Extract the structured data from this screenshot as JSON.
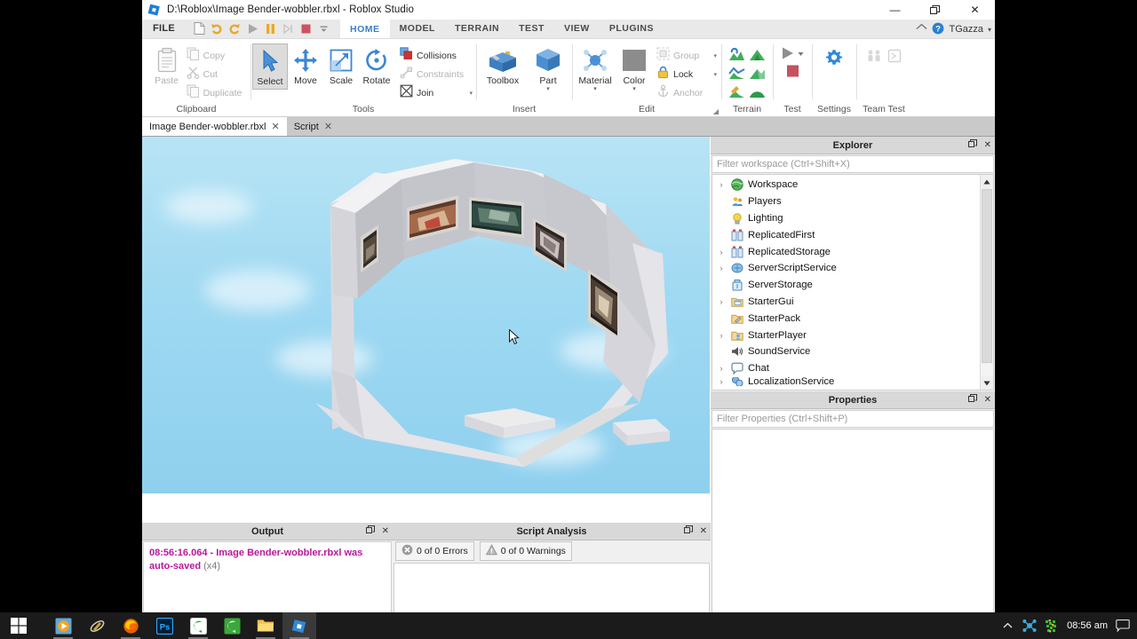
{
  "window": {
    "title": "D:\\Roblox\\Image Bender-wobbler.rbxl - Roblox Studio",
    "icon": "roblox-studio-icon",
    "minimize_label": "—",
    "restore_label": "❐",
    "close_label": "✕"
  },
  "ribbon": {
    "file_tab": "FILE",
    "quick_access": [
      {
        "name": "new-document",
        "label": "New"
      },
      {
        "name": "undo",
        "label": "Undo"
      },
      {
        "name": "redo",
        "label": "Redo"
      },
      {
        "name": "play",
        "label": "Play"
      },
      {
        "name": "pause",
        "label": "Pause"
      },
      {
        "name": "step",
        "label": "Step"
      },
      {
        "name": "stop",
        "label": "Stop"
      },
      {
        "name": "qat-overflow",
        "label": "More"
      }
    ],
    "tabs": [
      {
        "label": "HOME",
        "active": true
      },
      {
        "label": "MODEL",
        "active": false
      },
      {
        "label": "TERRAIN",
        "active": false
      },
      {
        "label": "TEST",
        "active": false
      },
      {
        "label": "VIEW",
        "active": false
      },
      {
        "label": "PLUGINS",
        "active": false
      }
    ],
    "account": {
      "home_icon": "home-icon",
      "help_icon": "help-icon",
      "user_name": "TGazza",
      "caret": "▾"
    },
    "groups": [
      {
        "name": "clipboard",
        "label": "Clipboard",
        "big": [
          {
            "label": "Paste",
            "icon": "paste-icon",
            "disabled": true
          }
        ],
        "small": [
          {
            "label": "Copy",
            "icon": "copy-icon",
            "disabled": true
          },
          {
            "label": "Cut",
            "icon": "cut-icon",
            "disabled": true
          },
          {
            "label": "Duplicate",
            "icon": "duplicate-icon",
            "disabled": true
          }
        ]
      },
      {
        "name": "tools",
        "label": "Tools",
        "big": [
          {
            "label": "Select",
            "icon": "select-arrow-icon",
            "selected": true
          },
          {
            "label": "Move",
            "icon": "move-icon"
          },
          {
            "label": "Scale",
            "icon": "scale-icon"
          },
          {
            "label": "Rotate",
            "icon": "rotate-icon"
          }
        ],
        "small": [
          {
            "label": "Collisions",
            "icon": "collisions-icon",
            "disabled": false
          },
          {
            "label": "Constraints",
            "icon": "constraints-icon",
            "disabled": true
          },
          {
            "label": "Join",
            "icon": "join-icon",
            "disabled": false,
            "caret": "▾"
          }
        ]
      },
      {
        "name": "insert",
        "label": "Insert",
        "big": [
          {
            "label": "Toolbox",
            "icon": "toolbox-icon"
          },
          {
            "label": "Part",
            "icon": "part-cube-icon",
            "caret": "▾"
          }
        ]
      },
      {
        "name": "edit",
        "label": "Edit",
        "big": [
          {
            "label": "Material",
            "icon": "material-icon",
            "caret": "▾"
          },
          {
            "label": "Color",
            "icon": "color-swatch-icon",
            "caret": "▾"
          }
        ],
        "small": [
          {
            "label": "Group",
            "icon": "group-icon",
            "disabled": true,
            "caret": "▾"
          },
          {
            "label": "Lock",
            "icon": "lock-icon",
            "disabled": false,
            "caret": "▾"
          },
          {
            "label": "Anchor",
            "icon": "anchor-icon",
            "disabled": true
          }
        ],
        "expander": "◢"
      },
      {
        "name": "terrain",
        "label": "Terrain",
        "tiles": [
          "terrain-editor-icon",
          "terrain-add-icon",
          "terrain-smooth-icon",
          "terrain-subtract-icon",
          "terrain-paint-icon",
          "terrain-grow-icon"
        ]
      },
      {
        "name": "test",
        "label": "Test",
        "tiles": [
          "play-solo-icon",
          "stop-icon"
        ]
      },
      {
        "name": "settings",
        "label": "Settings",
        "tiles": [
          "gear-icon"
        ]
      },
      {
        "name": "team-test",
        "label": "Team Test",
        "tiles": [
          "team-players-icon",
          "team-server-icon"
        ]
      }
    ]
  },
  "doctabs": [
    {
      "label": "Image Bender-wobbler.rbxl",
      "close": "✕",
      "active": true
    },
    {
      "label": "Script",
      "close": "✕",
      "active": false
    }
  ],
  "explorer": {
    "title": "Explorer",
    "float_icon": "❐",
    "close_icon": "✕",
    "filter_placeholder": "Filter workspace (Ctrl+Shift+X)",
    "items": [
      {
        "label": "Workspace",
        "icon": "workspace-globe-icon",
        "expandable": true
      },
      {
        "label": "Players",
        "icon": "players-icon",
        "expandable": false
      },
      {
        "label": "Lighting",
        "icon": "lighting-bulb-icon",
        "expandable": false
      },
      {
        "label": "ReplicatedFirst",
        "icon": "replicated-first-icon",
        "expandable": false
      },
      {
        "label": "ReplicatedStorage",
        "icon": "replicated-storage-icon",
        "expandable": true
      },
      {
        "label": "ServerScriptService",
        "icon": "server-script-service-icon",
        "expandable": true
      },
      {
        "label": "ServerStorage",
        "icon": "server-storage-icon",
        "expandable": false
      },
      {
        "label": "StarterGui",
        "icon": "starter-gui-icon",
        "expandable": true
      },
      {
        "label": "StarterPack",
        "icon": "starter-pack-icon",
        "expandable": false
      },
      {
        "label": "StarterPlayer",
        "icon": "starter-player-icon",
        "expandable": true
      },
      {
        "label": "SoundService",
        "icon": "sound-service-icon",
        "expandable": false
      },
      {
        "label": "Chat",
        "icon": "chat-bubble-icon",
        "expandable": true
      },
      {
        "label": "LocalizationService",
        "icon": "localization-service-icon",
        "expandable": true
      }
    ],
    "scroll_up": "▲",
    "scroll_down": "▼"
  },
  "properties": {
    "title": "Properties",
    "float_icon": "❐",
    "close_icon": "✕",
    "filter_placeholder": "Filter Properties (Ctrl+Shift+P)"
  },
  "output": {
    "title": "Output",
    "float_icon": "❐",
    "close_icon": "✕",
    "message": "08:56:16.064 - Image Bender-wobbler.rbxl was auto-saved",
    "count": "(x4)",
    "message_color": "#b8189b"
  },
  "script_analysis": {
    "title": "Script Analysis",
    "float_icon": "❐",
    "close_icon": "✕",
    "errors_label": "0 of 0 Errors",
    "errors_icon": "error-circle-icon",
    "warnings_label": "0 of 0 Warnings",
    "warnings_icon": "warning-icon"
  },
  "viewport": {
    "name": "3d-viewport",
    "sky_top": "#b8e4f5",
    "sky_bottom": "#8fd0ee",
    "wall_color": "#d9d9dd",
    "description": "Octagonal gallery structure with framed artwork on inner walls and a floating flat part in the center"
  },
  "taskbar": {
    "start_icon": "windows-start-icon",
    "items": [
      {
        "name": "media-player-icon",
        "running": true
      },
      {
        "name": "utility-icon",
        "running": false
      },
      {
        "name": "firefox-icon",
        "running": true
      },
      {
        "name": "photoshop-icon",
        "running": false
      },
      {
        "name": "camtasia-editor-icon",
        "running": true
      },
      {
        "name": "camtasia-recorder-icon",
        "running": false
      },
      {
        "name": "file-explorer-icon",
        "running": true
      },
      {
        "name": "roblox-studio-icon",
        "running": true,
        "active": true
      }
    ],
    "tray": {
      "chevron": "⌃",
      "icons": [
        "network-icon",
        "antivirus-icon"
      ],
      "clock": "08:56 am",
      "action_center": "notification-icon"
    }
  }
}
